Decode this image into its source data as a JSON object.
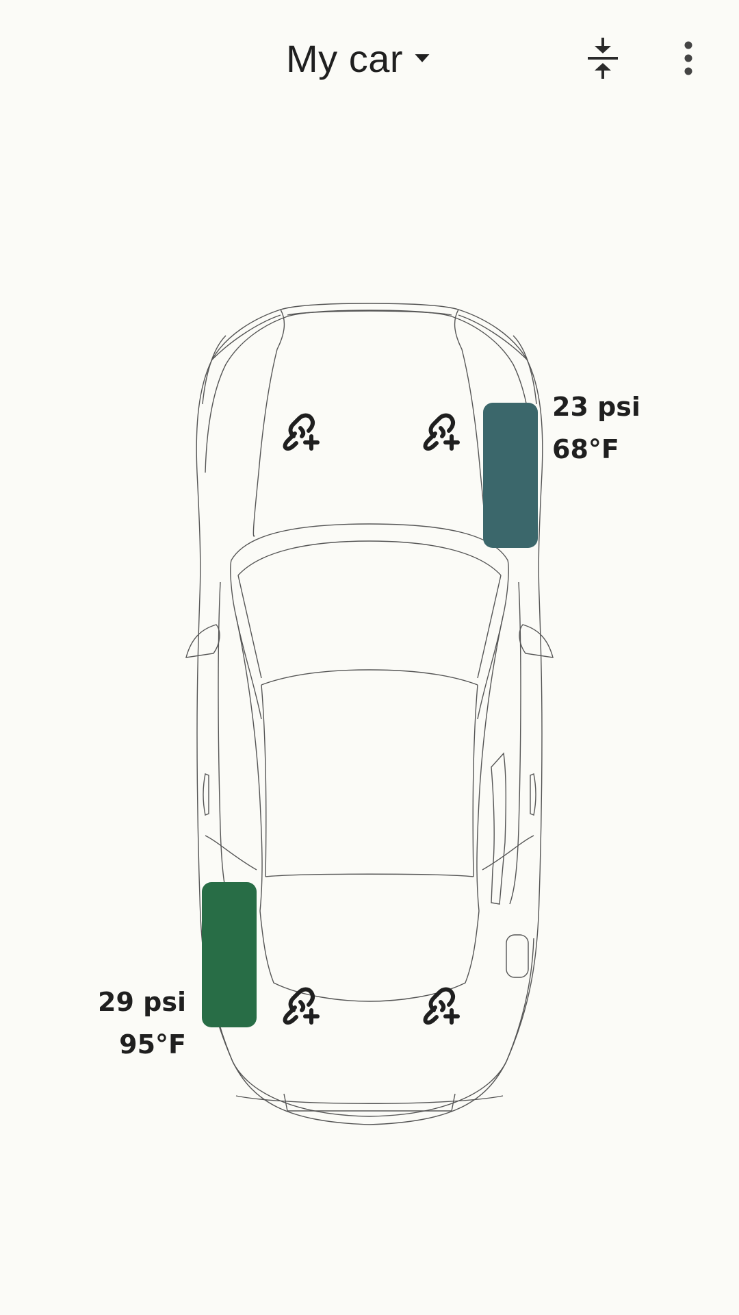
{
  "header": {
    "title": "My car",
    "title_icon": "arrow-drop-down-icon",
    "actions": [
      {
        "icon": "vertical-align-center-icon"
      },
      {
        "icon": "more-vert-icon"
      }
    ]
  },
  "tires": {
    "front_right": {
      "pressure": "23 psi",
      "temperature": "68°F",
      "color": "#3b676b"
    },
    "rear_left": {
      "pressure": "29 psi",
      "temperature": "95°F",
      "color": "#286d46"
    }
  },
  "sensor_slots": {
    "icon": "link-add-icon",
    "count": 4
  },
  "colors": {
    "background": "#fbfbf7",
    "text": "#1f1f1f",
    "outline": "#444444"
  }
}
